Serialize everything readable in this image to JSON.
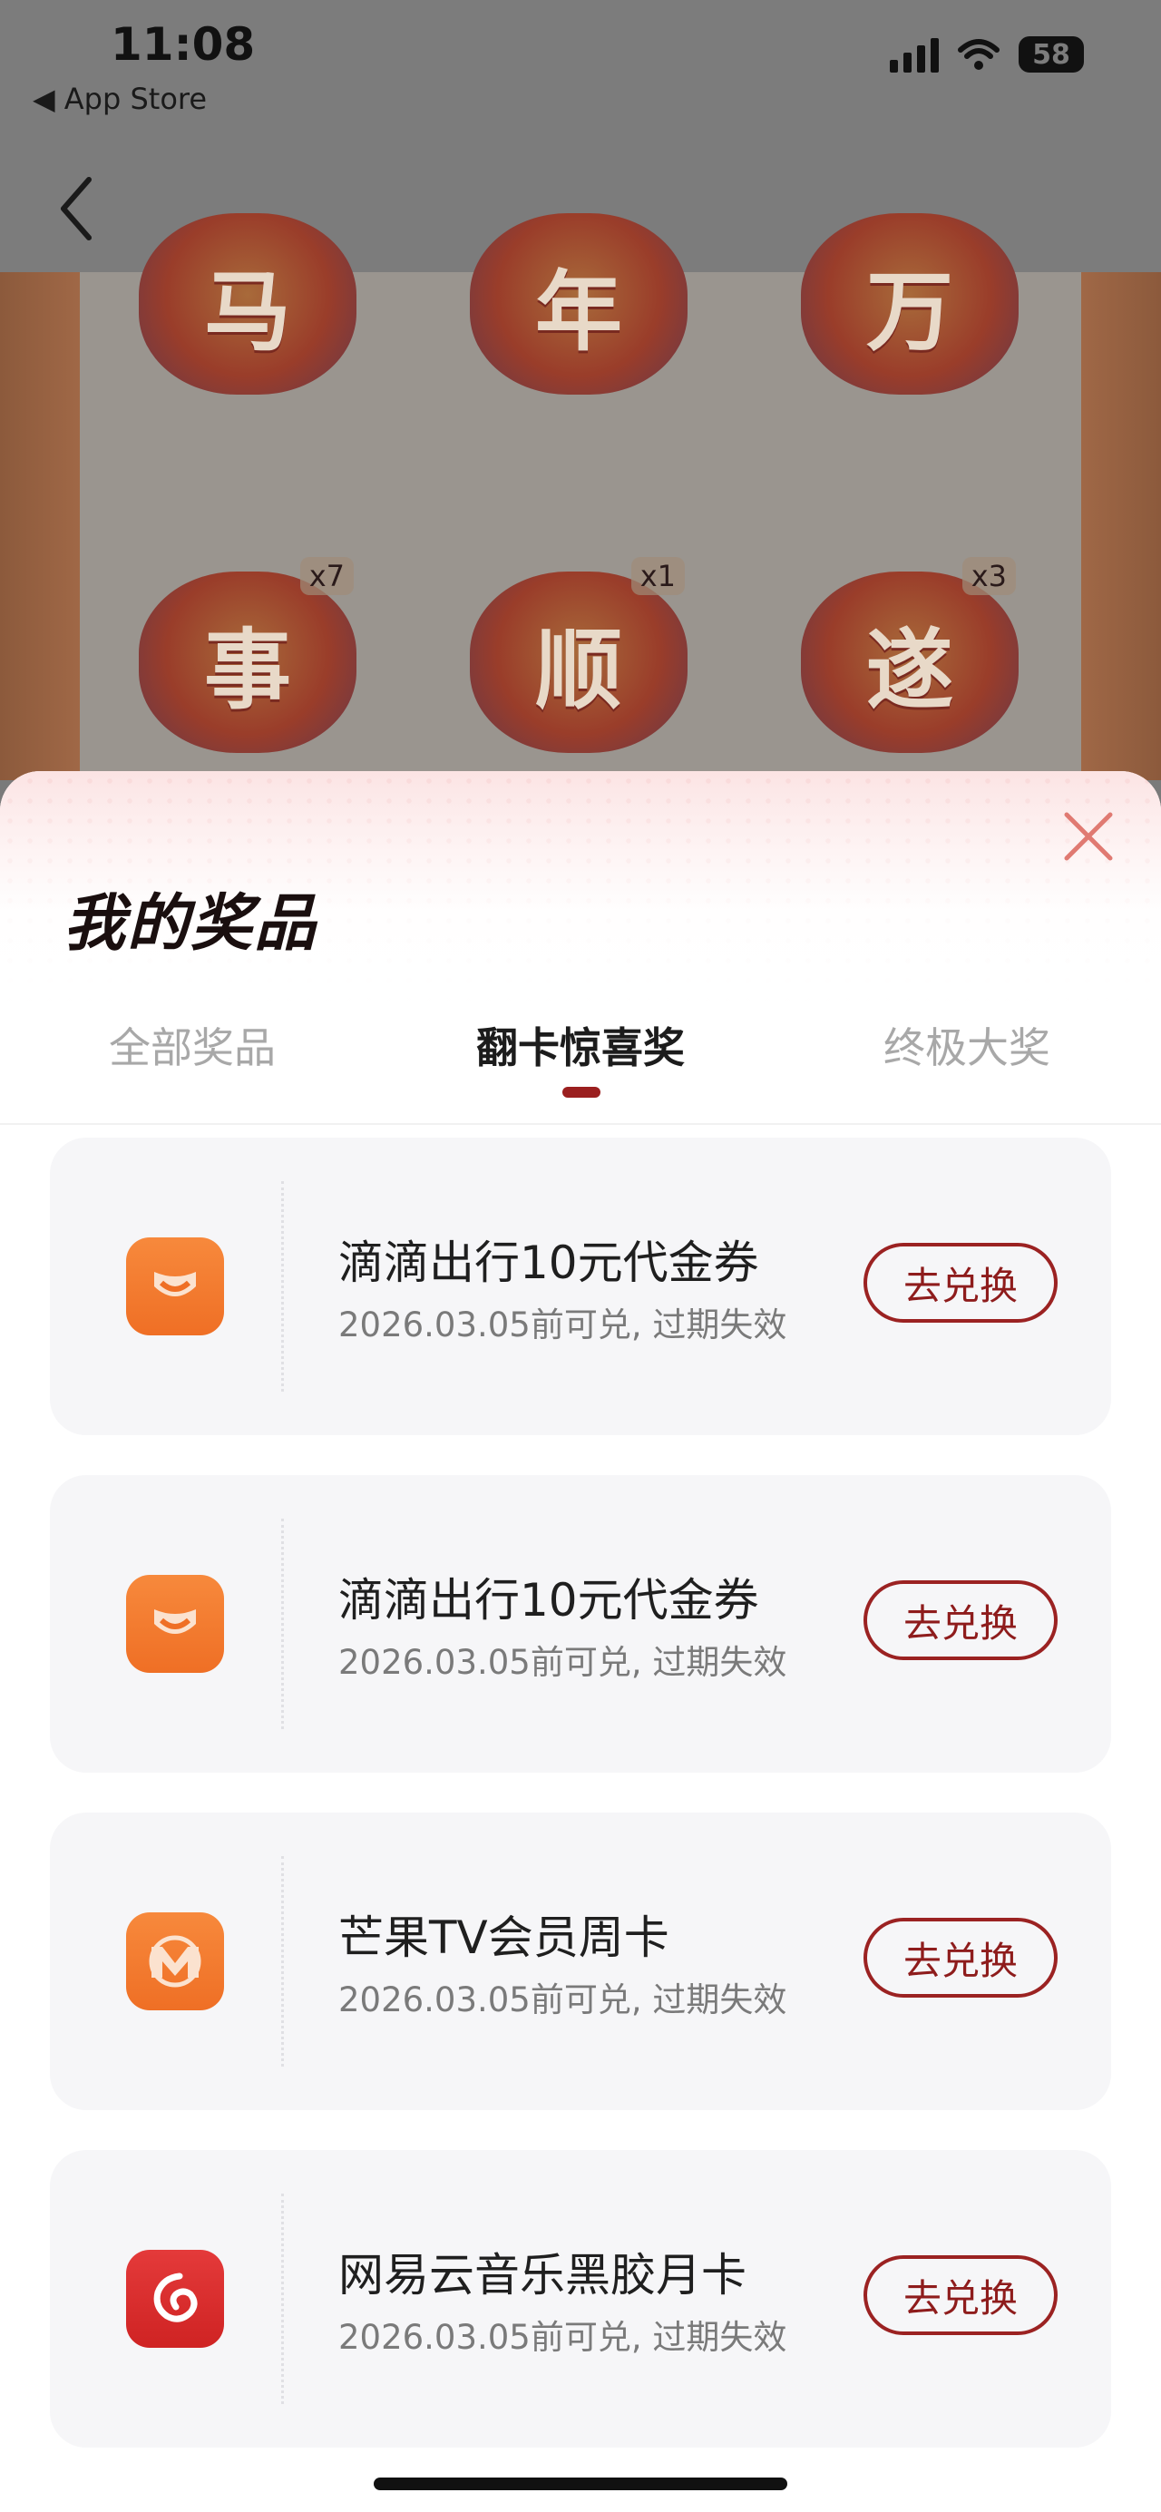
{
  "status_bar": {
    "time": "11:08",
    "back_app": "◀ App Store",
    "battery": "58"
  },
  "game": {
    "tiles": [
      {
        "char": "马",
        "count": ""
      },
      {
        "char": "年",
        "count": ""
      },
      {
        "char": "万",
        "count": ""
      },
      {
        "char": "事",
        "count": "x7"
      },
      {
        "char": "顺",
        "count": "x1"
      },
      {
        "char": "遂",
        "count": "x3"
      }
    ]
  },
  "sheet": {
    "title": "我的奖品",
    "tabs": [
      {
        "label": "全部奖品",
        "active": false
      },
      {
        "label": "翻卡惊喜奖",
        "active": true
      },
      {
        "label": "终极大奖",
        "active": false
      }
    ],
    "items": [
      {
        "icon": "didi-icon",
        "title": "滴滴出行10元代金券",
        "subtitle": "2026.03.05前可兑, 过期失效",
        "button": "去兑换"
      },
      {
        "icon": "didi-icon",
        "title": "滴滴出行10元代金券",
        "subtitle": "2026.03.05前可兑, 过期失效",
        "button": "去兑换"
      },
      {
        "icon": "mangotv-icon",
        "title": "芒果TV会员周卡",
        "subtitle": "2026.03.05前可兑, 过期失效",
        "button": "去兑换"
      },
      {
        "icon": "netease-music-icon",
        "title": "网易云音乐黑胶月卡",
        "subtitle": "2026.03.05前可兑, 过期失效",
        "button": "去兑换"
      }
    ]
  },
  "colors": {
    "accent": "#9b2222",
    "orange": "#f17a2e",
    "red": "#d92b2b"
  }
}
